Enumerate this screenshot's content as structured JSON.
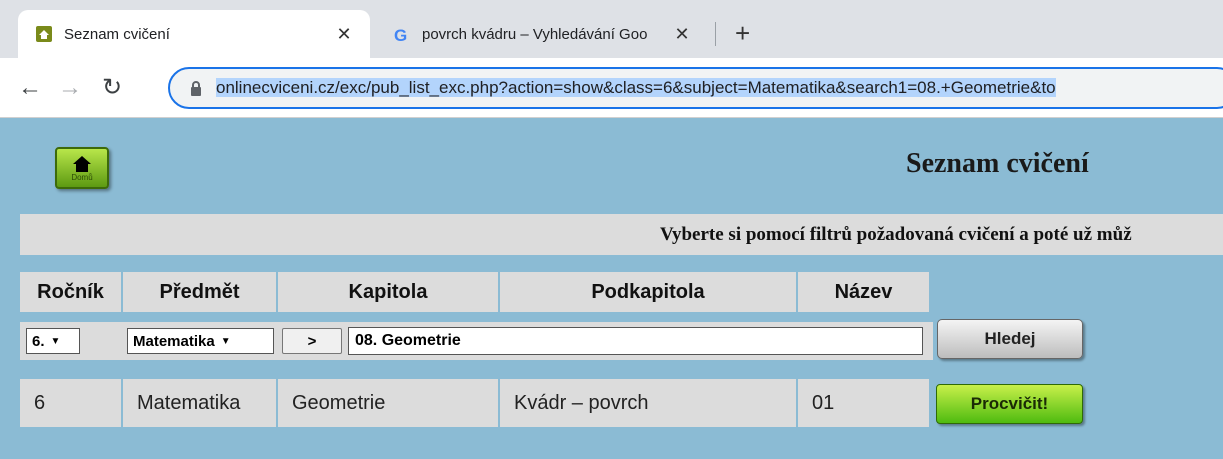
{
  "browser": {
    "tabs": [
      {
        "title": "Seznam cvičení",
        "icon": "site-favicon",
        "active": true
      },
      {
        "title": "povrch kvádru – Vyhledávání Goo",
        "icon": "google-favicon",
        "active": false
      }
    ],
    "url_display": "onlinecviceni.cz/exc/pub_list_exc.php?action=show&class=6&subject=Matematika&search1=08.+Geometrie&to"
  },
  "page": {
    "home_button_label": "Domů",
    "title": "Seznam cvičení",
    "banner": "Vyberte si pomocí filtrů požadovaná cvičení a poté už můž",
    "columns": [
      "Ročník",
      "Předmět",
      "Kapitola",
      "Podkapitola",
      "Název"
    ],
    "filters": {
      "rocnik": "6.",
      "predmet": "Matematika",
      "next_label": ">",
      "kapitola": "08. Geometrie",
      "search_label": "Hledej"
    },
    "rows": [
      {
        "rocnik": "6",
        "predmet": "Matematika",
        "kapitola": "Geometrie",
        "podkapitola": "Kvádr – povrch",
        "nazev": "01",
        "action": "Procvičit!"
      }
    ]
  },
  "colors": {
    "page_bg": "#8bbbd4",
    "cell_bg": "#dcdcdc",
    "accent_green": "#4fbb10",
    "omnibox_focus": "#1a73e8"
  }
}
